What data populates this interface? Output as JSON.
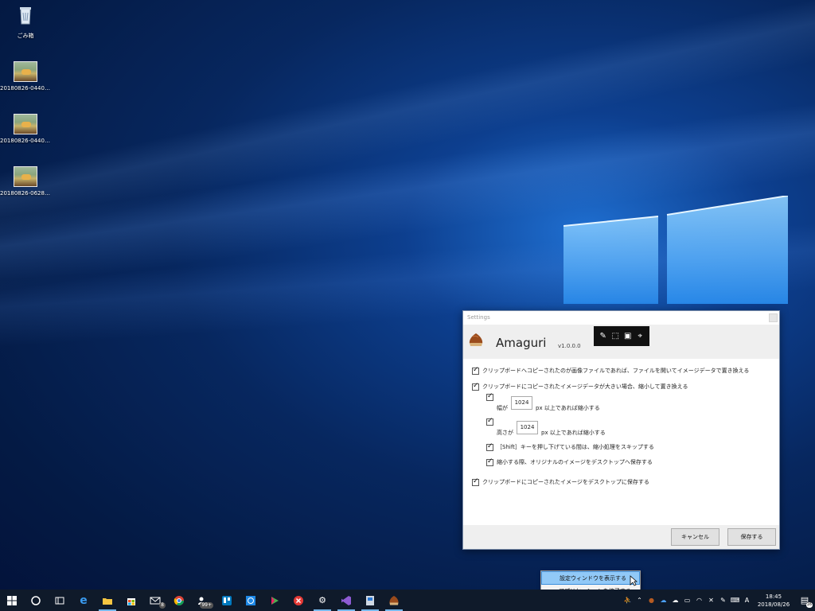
{
  "desktop": {
    "icons": [
      {
        "label": "ごみ箱",
        "icon": "recycle-bin-icon"
      },
      {
        "label": "20180826-04403...",
        "icon": "image-file-icon"
      },
      {
        "label": "20180826-04403...",
        "icon": "image-file-icon"
      },
      {
        "label": "20180826-06285...",
        "icon": "image-file-icon"
      }
    ]
  },
  "settings": {
    "title": "Settings",
    "app_name": "Amaguri",
    "version": "v1.0.0.0",
    "toolbar_icons": [
      "edit-icon",
      "screen-clip-icon",
      "window-capture-icon",
      "pin-icon"
    ],
    "options": {
      "replace_file": {
        "label": "クリップボードへコピーされたのが画像ファイルであれば、ファイルを開いてイメージデータで置き換える",
        "checked": true
      },
      "shrink_large": {
        "label": "クリップボードにコピーされたイメージデータが大きい場合、縮小して置き換える",
        "checked": true
      },
      "width": {
        "prefix": "幅が",
        "value": "1024",
        "suffix": "px 以上であれば縮小する",
        "checked": true
      },
      "height": {
        "prefix": "高さが",
        "value": "1024",
        "suffix": "px 以上であれば縮小する",
        "checked": true
      },
      "shift_skip": {
        "label": "［Shift］キーを押し下げている間は、縮小処理をスキップする",
        "checked": true
      },
      "save_original": {
        "label": "縮小する際、オリジナルのイメージをデスクトップへ保存する",
        "checked": true
      },
      "save_to_desktop": {
        "label": "クリップボードにコピーされたイメージをデスクトップに保存する",
        "checked": true
      }
    },
    "buttons": {
      "cancel": "キャンセル",
      "save": "保存する"
    }
  },
  "context_menu": {
    "items": [
      {
        "label": "設定ウィンドウを表示する",
        "highlighted": true
      },
      {
        "label": "アプリケーションを終了する",
        "highlighted": false
      }
    ]
  },
  "taskbar": {
    "apps": [
      {
        "name": "start-icon",
        "glyph": "⊞"
      },
      {
        "name": "cortana-icon",
        "glyph": "○"
      },
      {
        "name": "task-view-icon",
        "glyph": "⧉"
      },
      {
        "name": "edge-icon",
        "glyph": "e"
      },
      {
        "name": "file-explorer-icon",
        "glyph": "▬",
        "active": true
      },
      {
        "name": "store-icon",
        "glyph": "▣"
      },
      {
        "name": "mail-icon",
        "glyph": "✉",
        "badge": "8"
      },
      {
        "name": "chrome-icon",
        "glyph": "◉"
      },
      {
        "name": "people-icon",
        "glyph": "☺",
        "badge": "99+"
      },
      {
        "name": "trello-icon",
        "glyph": "▥"
      },
      {
        "name": "timer-icon",
        "glyph": "◷"
      },
      {
        "name": "media-icon",
        "glyph": "▶"
      },
      {
        "name": "close-app-icon",
        "glyph": "✖"
      },
      {
        "name": "settings-icon",
        "glyph": "⚙",
        "active": true
      },
      {
        "name": "visual-studio-icon",
        "glyph": "◈",
        "active": true
      },
      {
        "name": "app-icon",
        "glyph": "▤",
        "active": true
      },
      {
        "name": "amaguri-icon",
        "glyph": "●",
        "active": true
      }
    ],
    "tray_icons": [
      "person-icon",
      "chevron-up-icon",
      "amaguri-tray-icon",
      "onedrive-icon",
      "cloud-icon",
      "battery-icon",
      "wifi-icon",
      "mute-icon",
      "pen-icon",
      "keyboard-icon",
      "ime-icon"
    ],
    "ime_label": "A",
    "time": "18:45",
    "date": "2018/08/26",
    "notification_count": "16"
  }
}
